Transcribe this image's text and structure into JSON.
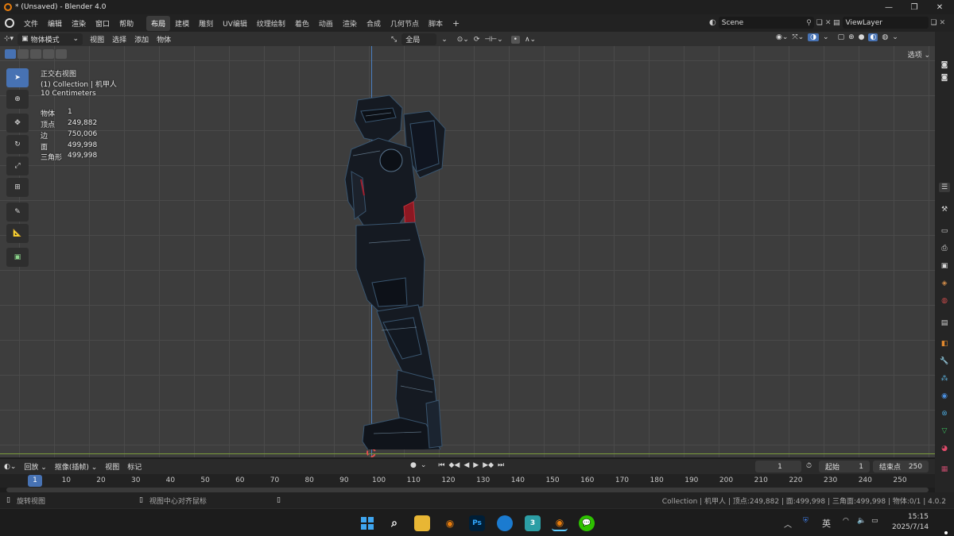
{
  "window": {
    "title": "* (Unsaved) - Blender 4.0"
  },
  "menu": {
    "items": [
      "文件",
      "编辑",
      "渲染",
      "窗口",
      "帮助"
    ]
  },
  "workspaces": {
    "tabs": [
      "布局",
      "建模",
      "雕刻",
      "UV编辑",
      "纹理绘制",
      "着色",
      "动画",
      "渲染",
      "合成",
      "几何节点",
      "脚本"
    ],
    "active": "布局",
    "add": "+"
  },
  "scene": {
    "name": "Scene",
    "view_layer": "ViewLayer"
  },
  "viewport_header": {
    "mode": "物体模式",
    "menu": [
      "视图",
      "选择",
      "添加",
      "物体"
    ],
    "orientation": "全局",
    "options_label": "选项"
  },
  "overlay": {
    "view_name": "正交右视图",
    "collection": "(1) Collection | 机甲人",
    "scale": "10 Centimeters",
    "stats": [
      {
        "label": "物体",
        "value": "1"
      },
      {
        "label": "顶点",
        "value": "249,882"
      },
      {
        "label": "边",
        "value": "750,006"
      },
      {
        "label": "面",
        "value": "499,998"
      },
      {
        "label": "三角形",
        "value": "499,998"
      }
    ]
  },
  "timeline": {
    "menu": [
      "回放",
      "抠像(插帧)",
      "视图",
      "标记"
    ],
    "current_frame": "1",
    "start_label": "起始",
    "start": "1",
    "end_label": "结束点",
    "end": "250",
    "ticks": [
      "1",
      "10",
      "20",
      "30",
      "40",
      "50",
      "60",
      "70",
      "80",
      "90",
      "100",
      "110",
      "120",
      "130",
      "140",
      "150",
      "160",
      "170",
      "180",
      "190",
      "200",
      "210",
      "220",
      "230",
      "240",
      "250"
    ]
  },
  "status": {
    "left_action": "旋转视图",
    "mid_action": "视图中心对齐鼠标",
    "info": "Collection | 机甲人 | 顶点:249,882 | 面:499,998 | 三角面:499,998 | 物体:0/1 | 4.0.2"
  },
  "taskbar": {
    "lang": "英",
    "time": "15:15",
    "date": "2025/7/14"
  },
  "colors": {
    "accent": "#4772b3",
    "viewport_bg": "#3d3d3d",
    "grid": "#4a4a4a",
    "axis_y": "#4a7fc0",
    "axis_x": "#7b9b3c"
  }
}
